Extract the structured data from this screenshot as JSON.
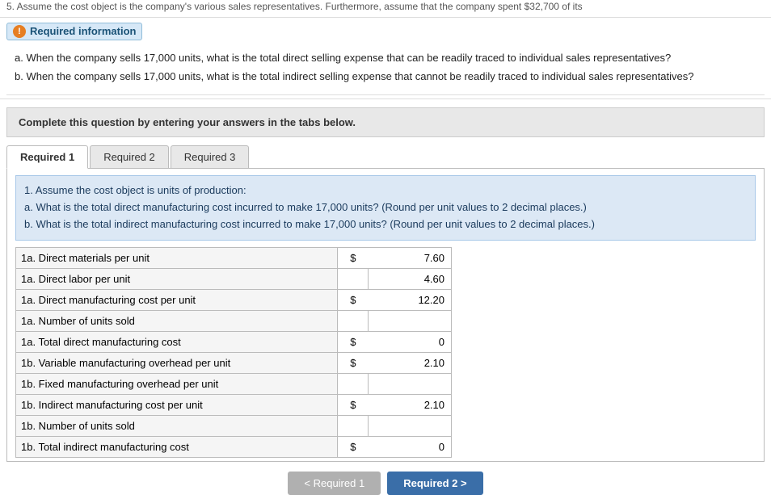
{
  "topText": "5. Assume the cost object is the company's various sales representatives. Furthermore, assume that the company spent $32,700 of its",
  "requiredInfo": {
    "icon": "!",
    "label": "Required information"
  },
  "questions": {
    "partA": "a. When the company sells 17,000 units, what is the total direct selling expense that can be readily traced to individual sales representatives?",
    "partB": "b. When the company sells 17,000 units, what is the total indirect selling expense that cannot be readily traced to individual sales representatives?"
  },
  "instruction": "Complete this question by entering your answers in the tabs below.",
  "tabs": [
    {
      "label": "Required 1",
      "active": true
    },
    {
      "label": "Required 2",
      "active": false
    },
    {
      "label": "Required 3",
      "active": false
    }
  ],
  "tabContent": {
    "instructions": [
      "1. Assume the cost object is units of production:",
      "a. What is the total direct manufacturing cost incurred to make 17,000 units? (Round per unit values to 2 decimal places.)",
      "b. What is the total indirect manufacturing cost incurred to make 17,000 units? (Round per unit values to 2 decimal places.)"
    ],
    "rows": [
      {
        "label": "1a. Direct materials per unit",
        "dollar": "$",
        "value": "7.60",
        "hasInput": false
      },
      {
        "label": "1a. Direct labor per unit",
        "dollar": "",
        "value": "4.60",
        "hasInput": false
      },
      {
        "label": "1a. Direct manufacturing cost per unit",
        "dollar": "$",
        "value": "12.20",
        "hasInput": false
      },
      {
        "label": "1a. Number of units sold",
        "dollar": "",
        "value": "",
        "hasInput": true
      },
      {
        "label": "1a. Total direct manufacturing cost",
        "dollar": "$",
        "value": "0",
        "hasInput": false
      },
      {
        "label": "1b. Variable manufacturing overhead per unit",
        "dollar": "$",
        "value": "2.10",
        "hasInput": false
      },
      {
        "label": "1b. Fixed manufacturing overhead per unit",
        "dollar": "",
        "value": "",
        "hasInput": true
      },
      {
        "label": "1b. Indirect manufacturing cost per unit",
        "dollar": "$",
        "value": "2.10",
        "hasInput": false
      },
      {
        "label": "1b. Number of units sold",
        "dollar": "",
        "value": "",
        "hasInput": true
      },
      {
        "label": "1b. Total indirect manufacturing cost",
        "dollar": "$",
        "value": "0",
        "hasInput": false
      }
    ]
  },
  "navButtons": {
    "prev": "< Required 1",
    "next": "Required 2 >"
  },
  "footer": {
    "required2": "Required 2"
  }
}
